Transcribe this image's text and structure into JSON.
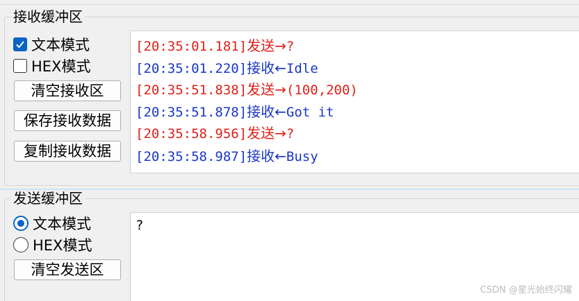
{
  "receive_buffer": {
    "title": "接收缓冲区",
    "text_mode_label": "文本模式",
    "text_mode_checked": true,
    "hex_mode_label": "HEX模式",
    "hex_mode_checked": false,
    "clear_button": "清空接收区",
    "save_button": "保存接收数据",
    "copy_button": "复制接收数据",
    "log": [
      {
        "kind": "sent",
        "timestamp": "[20:35:01.181]",
        "direction": "发送→",
        "message": "?"
      },
      {
        "kind": "recv",
        "timestamp": "[20:35:01.220]",
        "direction": "接收←",
        "message": "Idle"
      },
      {
        "kind": "sent",
        "timestamp": "[20:35:51.838]",
        "direction": "发送→",
        "message": "(100,200)"
      },
      {
        "kind": "recv",
        "timestamp": "[20:35:51.878]",
        "direction": "接收←",
        "message": "Got it"
      },
      {
        "kind": "sent",
        "timestamp": "[20:35:58.956]",
        "direction": "发送→",
        "message": "?"
      },
      {
        "kind": "recv",
        "timestamp": "[20:35:58.987]",
        "direction": "接收←",
        "message": "Busy"
      }
    ]
  },
  "send_buffer": {
    "title": "发送缓冲区",
    "text_mode_label": "文本模式",
    "text_mode_selected": true,
    "hex_mode_label": "HEX模式",
    "hex_mode_selected": false,
    "clear_button": "清空发送区",
    "content": "?"
  },
  "watermark": "CSDN @星光始终闪耀",
  "colors": {
    "sent": "#e0201b",
    "received": "#1a36c8",
    "accent": "#0a63c6"
  }
}
